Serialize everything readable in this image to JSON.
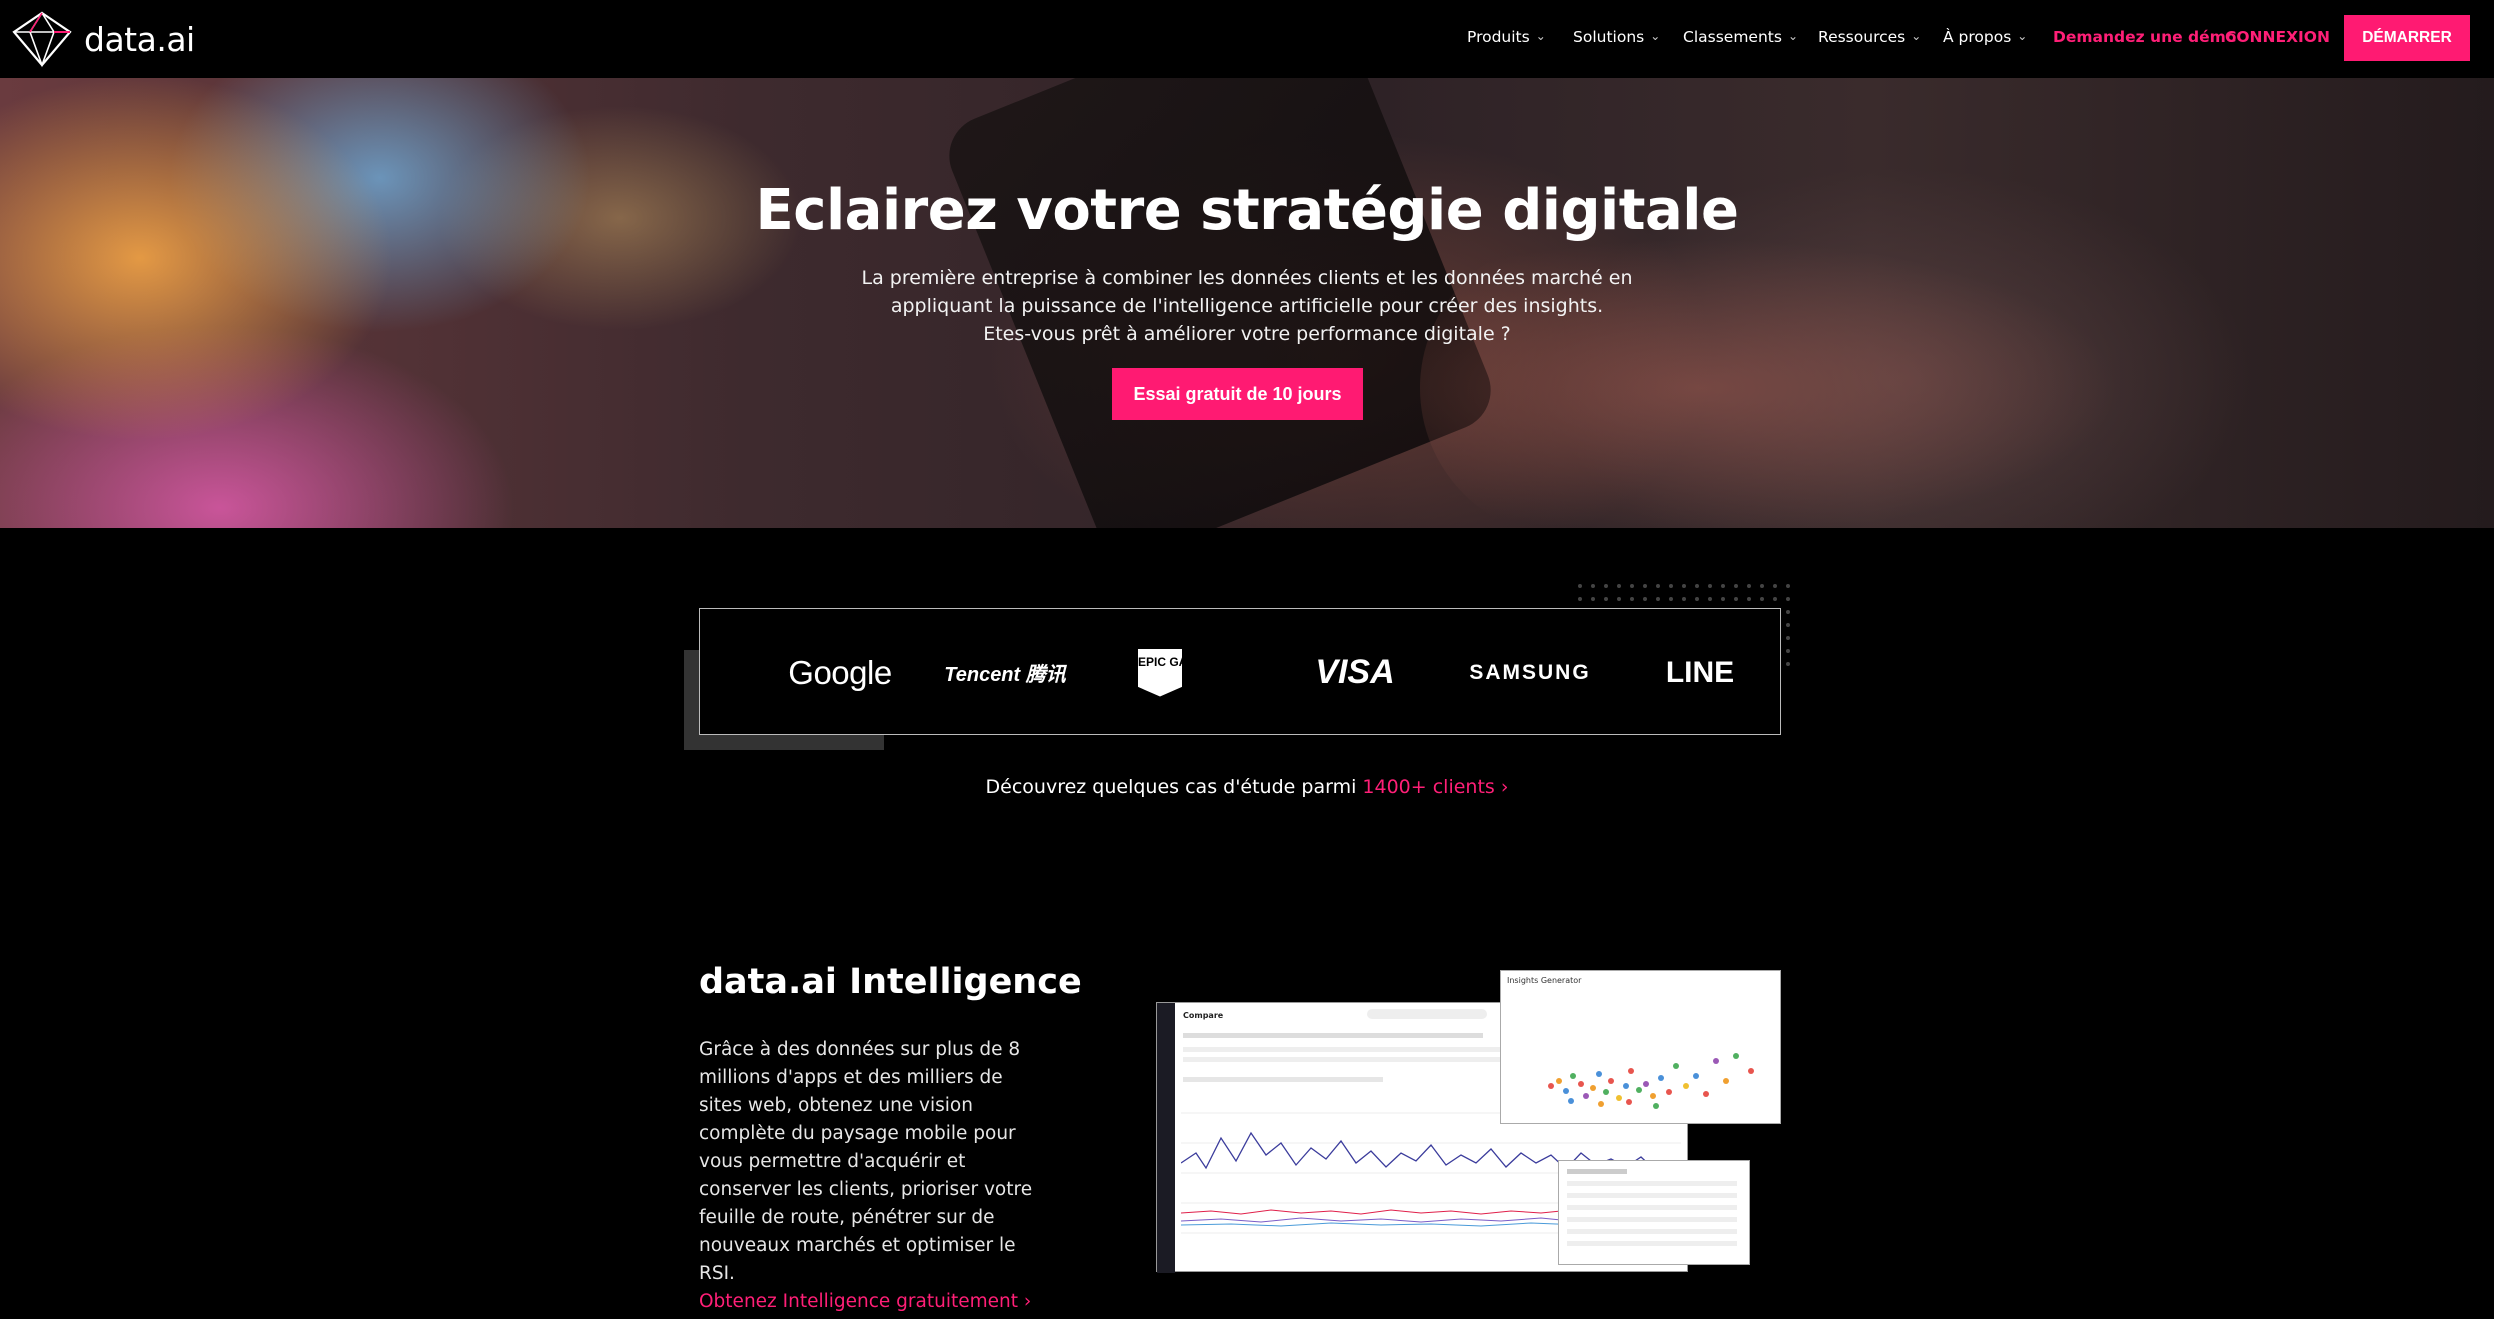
{
  "brand": {
    "name": "data.ai"
  },
  "nav": {
    "items": [
      {
        "label": "Produits"
      },
      {
        "label": "Solutions"
      },
      {
        "label": "Classements"
      },
      {
        "label": "Ressources"
      },
      {
        "label": "À propos"
      }
    ],
    "demo_label": "Demandez une démo",
    "login_label": "CONNEXION",
    "start_label": "DÉMARRER"
  },
  "hero": {
    "title": "Eclairez votre stratégie digitale",
    "subtitle_lines": [
      "La première entreprise à combiner les données clients et les données marché en",
      "appliquant la puissance de l'intelligence artificielle pour créer des insights.",
      "Etes-vous prêt à améliorer votre performance digitale ?"
    ],
    "cta_label": "Essai gratuit de 10 jours"
  },
  "clients": {
    "logos": [
      {
        "name": "Google"
      },
      {
        "name": "Tencent 腾讯"
      },
      {
        "name": "EPIC GAMES"
      },
      {
        "name": "VISA"
      },
      {
        "name": "SAMSUNG"
      },
      {
        "name": "LINE"
      }
    ],
    "cases_text": "Découvrez quelques cas d'étude parmi ",
    "cases_link": "1400+ clients ›"
  },
  "intelligence": {
    "title": "data.ai Intelligence",
    "description": "Grâce à des données sur plus de 8 millions d'apps et des milliers de sites web, obtenez une vision complète du paysage mobile pour vous permettre d'acquérir et conserver les clients, prioriser votre feuille de route, pénétrer sur de nouveaux marchés et optimiser le RSI.",
    "link_label": "Obtenez Intelligence gratuitement ›",
    "dashboard": {
      "title": "Compare",
      "insights_title": "Insights Generator"
    }
  },
  "colors": {
    "accent": "#ff1a72",
    "background": "#000000"
  }
}
